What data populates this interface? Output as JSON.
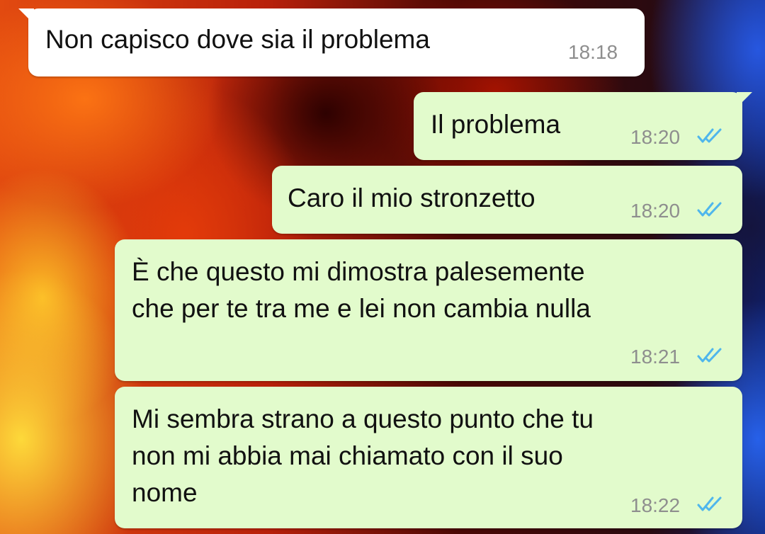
{
  "chat": {
    "messages": [
      {
        "direction": "incoming",
        "text": "Non capisco dove sia il problema",
        "time": "18:18"
      },
      {
        "direction": "outgoing",
        "text": "Il problema",
        "time": "18:20",
        "status": "double-check-read-icon"
      },
      {
        "direction": "outgoing",
        "text": "Caro il mio stronzetto",
        "time": "18:20",
        "status": "double-check-read-icon"
      },
      {
        "direction": "outgoing",
        "text": "È che questo mi dimostra palesemente\nche per te tra me e lei non cambia nulla",
        "time": "18:21",
        "status": "double-check-read-icon"
      },
      {
        "direction": "outgoing",
        "text": "Mi sembra strano a questo punto che tu\nnon mi abbia mai chiamato con il suo\nnome",
        "time": "18:22",
        "status": "double-check-read-icon"
      }
    ]
  },
  "colors": {
    "incoming_bubble": "#ffffff",
    "outgoing_bubble": "#e2fbcc",
    "read_ticks": "#4fb6ec",
    "timestamp": "#8e8e8e"
  }
}
